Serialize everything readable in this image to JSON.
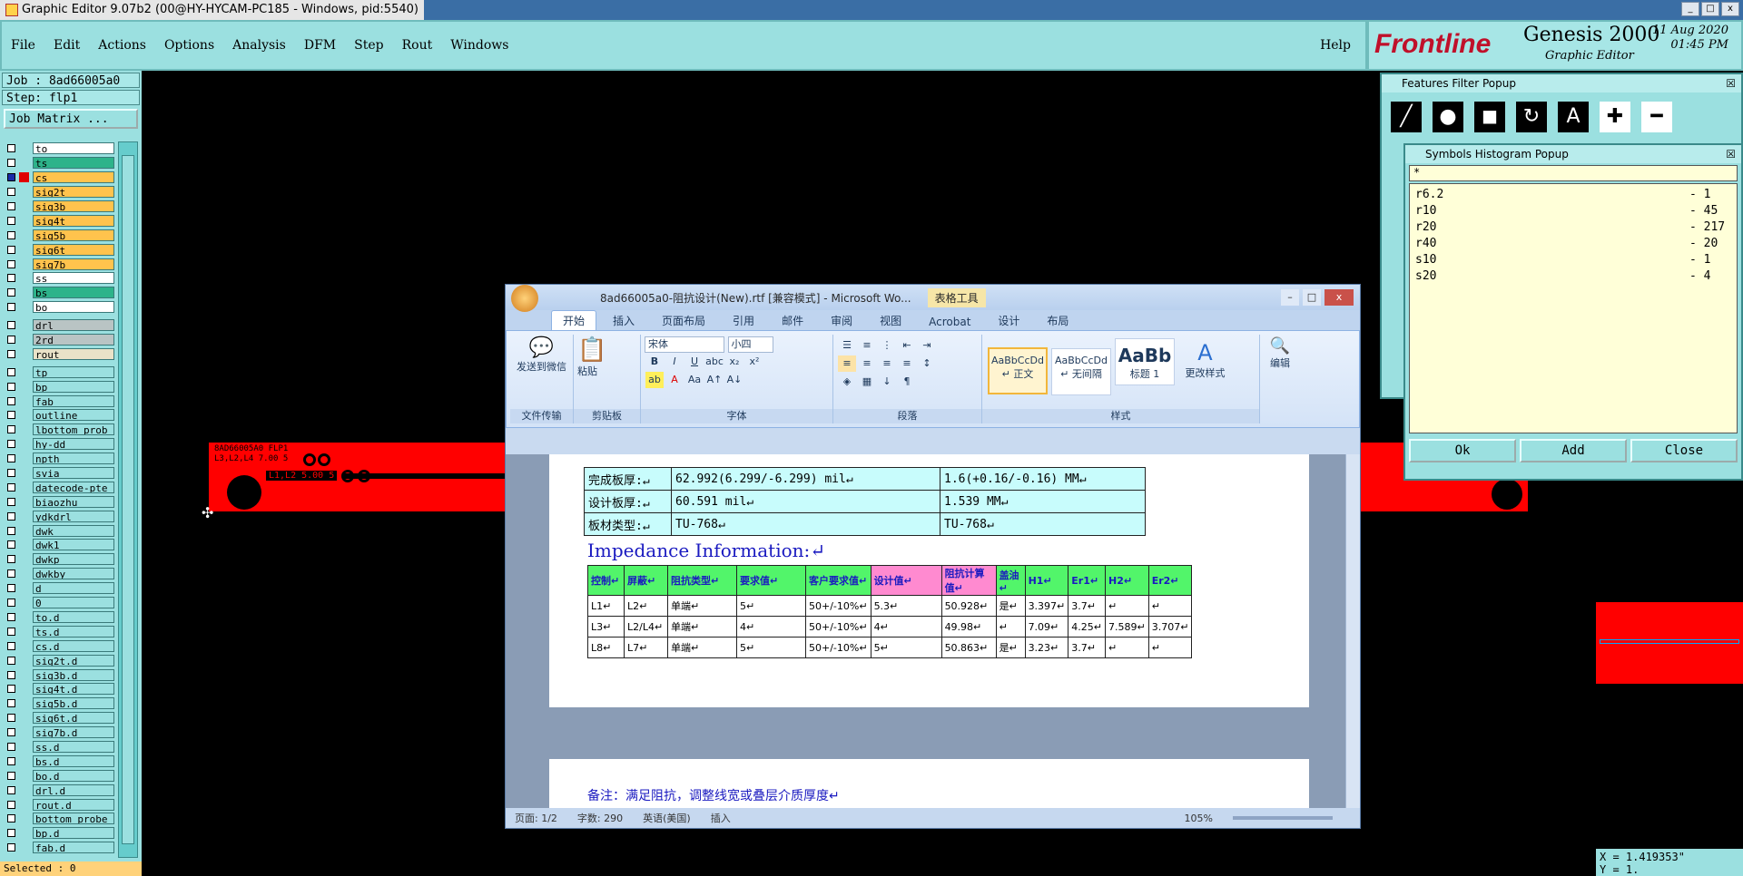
{
  "window": {
    "title": "Graphic Editor 9.07b2 (00@HY-HYCAM-PC185 - Windows, pid:5540)"
  },
  "menu": {
    "items": [
      "File",
      "Edit",
      "Actions",
      "Options",
      "Analysis",
      "DFM",
      "Step",
      "Rout",
      "Windows"
    ],
    "help": "Help"
  },
  "brand": {
    "logo": "Frontline",
    "product": "Genesis 2000",
    "subtitle": "Graphic Editor",
    "date": "11 Aug 2020",
    "time": "01:45 PM"
  },
  "job": {
    "line": "Job : 8ad66005a0",
    "step": "Step: flp1",
    "matrix_button": "Job Matrix ..."
  },
  "layers": [
    {
      "name": "to",
      "bg": "#ffffff",
      "sw": ""
    },
    {
      "name": "ts",
      "bg": "#2db38a",
      "sw": ""
    },
    {
      "name": "cs",
      "bg": "#ffc34d",
      "sw": "#e00000",
      "active": true
    },
    {
      "name": "sig2t",
      "bg": "#ffc34d",
      "sw": ""
    },
    {
      "name": "sig3b",
      "bg": "#ffc34d",
      "sw": ""
    },
    {
      "name": "sig4t",
      "bg": "#ffc34d",
      "sw": ""
    },
    {
      "name": "sig5b",
      "bg": "#ffc34d",
      "sw": ""
    },
    {
      "name": "sig6t",
      "bg": "#ffc34d",
      "sw": ""
    },
    {
      "name": "sig7b",
      "bg": "#ffc34d",
      "sw": ""
    },
    {
      "name": "ss",
      "bg": "#ffffff",
      "sw": ""
    },
    {
      "name": "bs",
      "bg": "#2db38a",
      "sw": ""
    },
    {
      "name": "bo",
      "bg": "#ffffff",
      "sw": ""
    },
    {
      "name": "drl",
      "bg": "#b9c4c4",
      "sw": ""
    },
    {
      "name": "2rd",
      "bg": "#b9c4c4",
      "sw": ""
    },
    {
      "name": "rout",
      "bg": "#e9e2c8",
      "sw": ""
    },
    {
      "name": "tp",
      "bg": "#9be0e0",
      "sw": ""
    },
    {
      "name": "bp",
      "bg": "#9be0e0",
      "sw": ""
    },
    {
      "name": "fab",
      "bg": "#9be0e0",
      "sw": ""
    },
    {
      "name": "outline",
      "bg": "#9be0e0",
      "sw": ""
    },
    {
      "name": "lbottom_prob",
      "bg": "#9be0e0",
      "sw": ""
    },
    {
      "name": "hy-dd",
      "bg": "#9be0e0",
      "sw": ""
    },
    {
      "name": "npth",
      "bg": "#9be0e0",
      "sw": ""
    },
    {
      "name": "svia",
      "bg": "#9be0e0",
      "sw": ""
    },
    {
      "name": "datecode-pte",
      "bg": "#9be0e0",
      "sw": ""
    },
    {
      "name": "biaozhu",
      "bg": "#9be0e0",
      "sw": ""
    },
    {
      "name": "ydkdrl",
      "bg": "#9be0e0",
      "sw": ""
    },
    {
      "name": "dwk",
      "bg": "#9be0e0",
      "sw": ""
    },
    {
      "name": "dwk1",
      "bg": "#9be0e0",
      "sw": ""
    },
    {
      "name": "dwkp",
      "bg": "#9be0e0",
      "sw": ""
    },
    {
      "name": "dwkby",
      "bg": "#9be0e0",
      "sw": ""
    },
    {
      "name": "d",
      "bg": "#9be0e0",
      "sw": ""
    },
    {
      "name": "0",
      "bg": "#9be0e0",
      "sw": ""
    },
    {
      "name": "to.d",
      "bg": "#9be0e0",
      "sw": ""
    },
    {
      "name": "ts.d",
      "bg": "#9be0e0",
      "sw": ""
    },
    {
      "name": "cs.d",
      "bg": "#9be0e0",
      "sw": ""
    },
    {
      "name": "sig2t.d",
      "bg": "#9be0e0",
      "sw": ""
    },
    {
      "name": "sig3b.d",
      "bg": "#9be0e0",
      "sw": ""
    },
    {
      "name": "sig4t.d",
      "bg": "#9be0e0",
      "sw": ""
    },
    {
      "name": "sig5b.d",
      "bg": "#9be0e0",
      "sw": ""
    },
    {
      "name": "sig6t.d",
      "bg": "#9be0e0",
      "sw": ""
    },
    {
      "name": "sig7b.d",
      "bg": "#9be0e0",
      "sw": ""
    },
    {
      "name": "ss.d",
      "bg": "#9be0e0",
      "sw": ""
    },
    {
      "name": "bs.d",
      "bg": "#9be0e0",
      "sw": ""
    },
    {
      "name": "bo.d",
      "bg": "#9be0e0",
      "sw": ""
    },
    {
      "name": "drl.d",
      "bg": "#9be0e0",
      "sw": ""
    },
    {
      "name": "rout.d",
      "bg": "#9be0e0",
      "sw": ""
    },
    {
      "name": "bottom_probe",
      "bg": "#9be0e0",
      "sw": ""
    },
    {
      "name": "bp.d",
      "bg": "#9be0e0",
      "sw": ""
    },
    {
      "name": "fab.d",
      "bg": "#9be0e0",
      "sw": ""
    }
  ],
  "selected": "Selected : 0",
  "pcb": {
    "label1": "8AD66005A0 FLP1",
    "label2": "L3,L2,L4 7.00 5",
    "label3": "L1,L2 5.00 5"
  },
  "word": {
    "title": "8ad66005a0-阻抗设计(New).rtf [兼容模式] - Microsoft Wo...",
    "context_tab": "表格工具",
    "tabs": [
      "开始",
      "插入",
      "页面布局",
      "引用",
      "邮件",
      "审阅",
      "视图",
      "Acrobat",
      "设计",
      "布局"
    ],
    "groups": {
      "send": "发送到微信",
      "file": "文件传输",
      "paste": "粘贴",
      "clipboard": "剪贴板",
      "font_name": "宋体",
      "font_size": "小四",
      "font": "字体",
      "paragraph": "段落",
      "styles_label": "样式",
      "change_styles": "更改样式",
      "edit": "编辑"
    },
    "styles": [
      {
        "preview": "AaBbCcDd",
        "name": "↵ 正文"
      },
      {
        "preview": "AaBbCcDd",
        "name": "↵ 无间隔"
      },
      {
        "preview": "AaBb",
        "name": "标题 1"
      }
    ],
    "board": [
      [
        "完成板厚:↵",
        "62.992(6.299/-6.299) mil↵",
        "1.6(+0.16/-0.16) MM↵"
      ],
      [
        "设计板厚:↵",
        "60.591 mil↵",
        "1.539 MM↵"
      ],
      [
        "板材类型:↵",
        "TU-768↵",
        "TU-768↵"
      ]
    ],
    "impedance_title": "Impedance Information:↵",
    "headers": [
      "控制↵",
      "屏蔽↵",
      "阻抗类型↵",
      "要求值↵",
      "客户要求值↵",
      "设计值↵",
      "阻抗计算值↵",
      "盖油↵",
      "H1↵",
      "Er1↵",
      "H2↵",
      "Er2↵"
    ],
    "rows": [
      [
        "L1↵",
        "L2↵",
        "单端↵",
        "5↵",
        "50+/-10%↵",
        "5.3↵",
        "50.928↵",
        "是↵",
        "3.397↵",
        "3.7↵",
        "↵",
        "↵"
      ],
      [
        "L3↵",
        "L2/L4↵",
        "单端↵",
        "4↵",
        "50+/-10%↵",
        "4↵",
        "49.98↵",
        "↵",
        "7.09↵",
        "4.25↵",
        "7.589↵",
        "3.707↵"
      ],
      [
        "L8↵",
        "L7↵",
        "单端↵",
        "5↵",
        "50+/-10%↵",
        "5↵",
        "50.863↵",
        "是↵",
        "3.23↵",
        "3.7↵",
        "↵",
        "↵"
      ]
    ],
    "note": "备注：满足阻抗，调整线宽或叠层介质厚度↵",
    "status": {
      "page": "页面: 1/2",
      "words": "字数: 290",
      "lang": "英语(美国)",
      "mode": "插入",
      "zoom": "105%"
    }
  },
  "filter": {
    "title": "Features Filter Popup"
  },
  "histogram": {
    "title": "Symbols Histogram Popup",
    "filter": "*",
    "items": [
      {
        "sym": "r6.2",
        "count": "- 1"
      },
      {
        "sym": "r10",
        "count": "- 45"
      },
      {
        "sym": "r20",
        "count": "- 217"
      },
      {
        "sym": "r40",
        "count": "- 20"
      },
      {
        "sym": "s10",
        "count": "- 1"
      },
      {
        "sym": "s20",
        "count": "- 4"
      }
    ],
    "ok": "Ok",
    "add": "Add",
    "close": "Close"
  },
  "coords": {
    "x": "X = 1.419353\"",
    "y": "Y = 1."
  }
}
